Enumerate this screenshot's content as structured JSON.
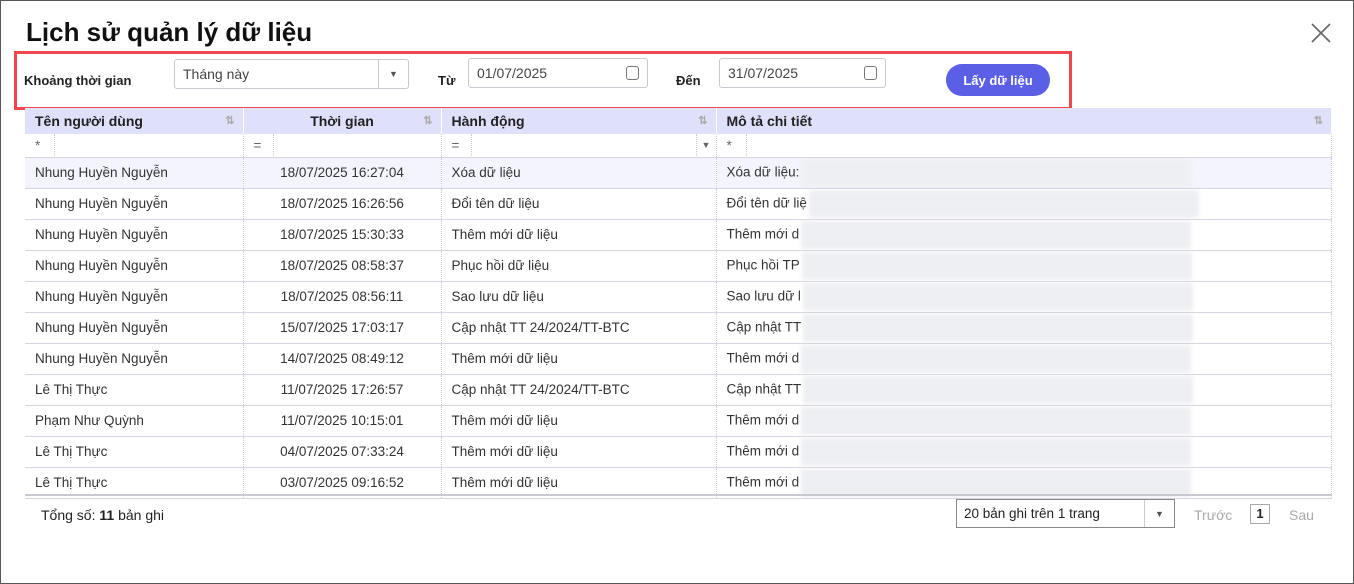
{
  "title": "Lịch sử quản lý dữ liệu",
  "filters": {
    "range_label": "Khoảng thời gian",
    "range_value": "Tháng này",
    "from_label": "Từ",
    "from_value": "01/07/2025",
    "to_label": "Đến",
    "to_value": "31/07/2025",
    "fetch_button": "Lấy dữ liệu"
  },
  "accent": "#5b5fe6",
  "columns": [
    "Tên người dùng",
    "Thời gian",
    "Hành động",
    "Mô tả chi tiết"
  ],
  "filter_ops": [
    "*",
    "=",
    "=",
    "*"
  ],
  "rows": [
    {
      "user": "Nhung Huyền Nguyễn",
      "time": "18/07/2025 16:27:04",
      "action": "Xóa dữ liệu",
      "desc": "Xóa dữ liệu:"
    },
    {
      "user": "Nhung Huyền Nguyễn",
      "time": "18/07/2025 16:26:56",
      "action": "Đổi tên dữ liệu",
      "desc": "Đổi tên dữ liệ"
    },
    {
      "user": "Nhung Huyền Nguyễn",
      "time": "18/07/2025 15:30:33",
      "action": "Thêm mới dữ liệu",
      "desc": "Thêm mới d"
    },
    {
      "user": "Nhung Huyền Nguyễn",
      "time": "18/07/2025 08:58:37",
      "action": "Phục hồi dữ liệu",
      "desc": "Phục hồi TP"
    },
    {
      "user": "Nhung Huyền Nguyễn",
      "time": "18/07/2025 08:56:11",
      "action": "Sao lưu dữ liệu",
      "desc": "Sao lưu dữ l"
    },
    {
      "user": "Nhung Huyền Nguyễn",
      "time": "15/07/2025 17:03:17",
      "action": "Cập nhật TT 24/2024/TT-BTC",
      "desc": "Cập nhật TT"
    },
    {
      "user": "Nhung Huyền Nguyễn",
      "time": "14/07/2025 08:49:12",
      "action": "Thêm mới dữ liệu",
      "desc": "Thêm mới d"
    },
    {
      "user": "Lê Thị Thực",
      "time": "11/07/2025 17:26:57",
      "action": "Cập nhật TT 24/2024/TT-BTC",
      "desc": "Cập nhật TT"
    },
    {
      "user": "Phạm Như Quỳnh",
      "time": "11/07/2025 10:15:01",
      "action": "Thêm mới dữ liệu",
      "desc": "Thêm mới d"
    },
    {
      "user": "Lê Thị Thực",
      "time": "04/07/2025 07:33:24",
      "action": "Thêm mới dữ liệu",
      "desc": "Thêm mới d"
    },
    {
      "user": "Lê Thị Thực",
      "time": "03/07/2025 09:16:52",
      "action": "Thêm mới dữ liệu",
      "desc": "Thêm mới d"
    }
  ],
  "footer": {
    "total_prefix": "Tổng số:",
    "total_count": "11",
    "total_suffix": "bản ghi",
    "page_size": "20 bản ghi trên 1 trang",
    "prev": "Trước",
    "page": "1",
    "next": "Sau"
  }
}
